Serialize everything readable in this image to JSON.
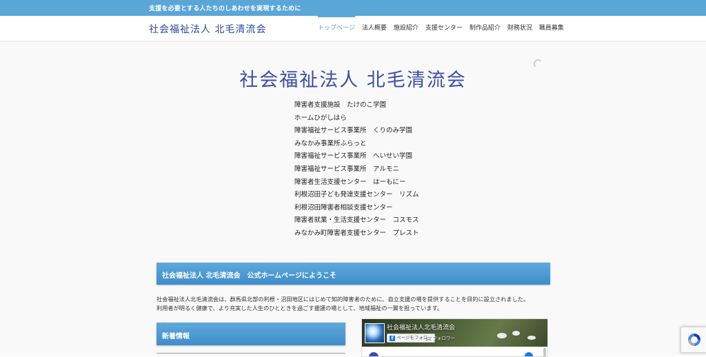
{
  "topbar": {
    "tagline": "支援を必要とする人たちのしあわせを実現するために"
  },
  "header": {
    "logo": "社会福祉法人 北毛清流会",
    "nav": [
      {
        "label": "トップページ",
        "active": true
      },
      {
        "label": "法人概要",
        "active": false
      },
      {
        "label": "施設紹介",
        "active": false
      },
      {
        "label": "支援センター",
        "active": false
      },
      {
        "label": "制作品紹介",
        "active": false
      },
      {
        "label": "財務状況",
        "active": false
      },
      {
        "label": "職員募集",
        "active": false
      }
    ]
  },
  "hero": {
    "title": "社会福祉法人 北毛清流会",
    "facilities": [
      "障害者支援施設　たけのこ学園",
      "ホームひがしはら",
      "障害福祉サービス事業所　くりのみ学園",
      "みなかみ事業所ふらっと",
      "障害福祉サービス事業所　へいせい学園",
      "障害福祉サービス事業所　アルモニ",
      "障害者生活支援センター　はーもにー",
      "利根沼田子ども発達支援センター　リズム",
      "利根沼田障害者相談支援センター",
      "障害者就業・生活支援センター　コスモス",
      "みなかみ町障害者支援センター　プレスト"
    ]
  },
  "welcome": {
    "heading": "社会福祉法人 北毛清流会　公式ホームページにようこそ",
    "lines": [
      "社会福祉法人北毛清流会は、群馬県北部の利根・沼田地区にはじめて知的障害者のために、自立支援の場を提供することを目的に設立されました。",
      "利用者が明るく健康で、より充実した人生のひとときを過ごす援護の場として、地域福祉の一翼を担っています。"
    ]
  },
  "news": {
    "heading": "新着情報"
  },
  "facebook": {
    "page_name": "社会福祉法人北毛清流会",
    "follow_label": "ページをフォロー",
    "follower_count": "54 フォロワー"
  },
  "colors": {
    "accent": "#5aa6d6",
    "logo_blue": "#2b4a9c",
    "facebook_blue": "#1877f2"
  },
  "icons": {
    "recaptcha": "recaptcha-icon",
    "facebook": "facebook-f-icon"
  }
}
